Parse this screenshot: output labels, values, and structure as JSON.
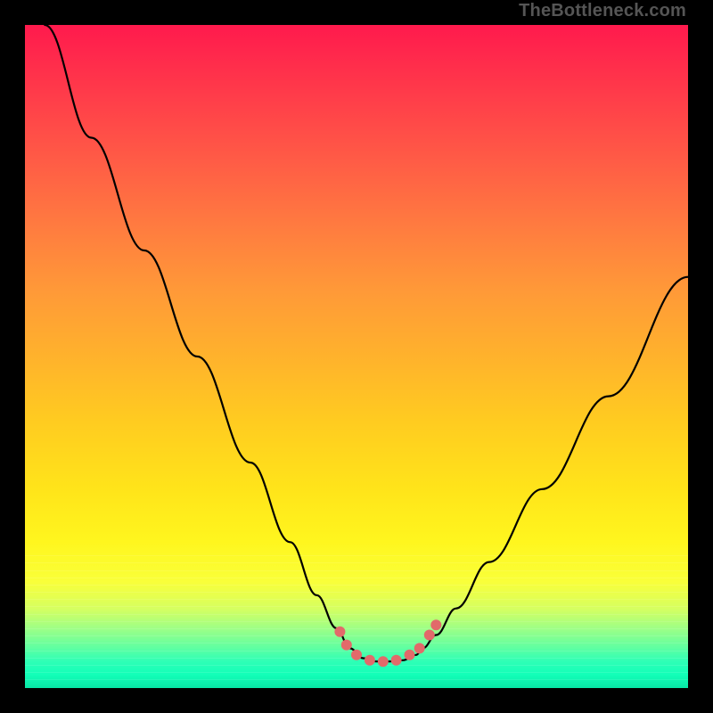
{
  "watermark": "TheBottleneck.com",
  "chart_data": {
    "type": "line",
    "title": "",
    "xlabel": "",
    "ylabel": "",
    "xlim": [
      0,
      100
    ],
    "ylim": [
      0,
      100
    ],
    "series": [
      {
        "name": "bottleneck-curve",
        "x": [
          3,
          10,
          18,
          26,
          34,
          40,
          44,
          47,
          49,
          51,
          53,
          55,
          57,
          59,
          60,
          62,
          65,
          70,
          78,
          88,
          100
        ],
        "y": [
          100,
          83,
          66,
          50,
          34,
          22,
          14,
          9,
          6,
          4.5,
          4,
          4,
          4.2,
          5,
          6,
          8,
          12,
          19,
          30,
          44,
          62
        ]
      }
    ],
    "markers": {
      "name": "highlight-dots",
      "color": "#e26a6a",
      "points": [
        {
          "x": 47.5,
          "y": 8.5
        },
        {
          "x": 48.5,
          "y": 6.5
        },
        {
          "x": 50,
          "y": 5
        },
        {
          "x": 52,
          "y": 4.2
        },
        {
          "x": 54,
          "y": 4
        },
        {
          "x": 56,
          "y": 4.2
        },
        {
          "x": 58,
          "y": 5
        },
        {
          "x": 59.5,
          "y": 6
        },
        {
          "x": 61,
          "y": 8
        },
        {
          "x": 62,
          "y": 9.5
        }
      ]
    },
    "gradient_stops": [
      {
        "pos": 0,
        "color": "#ff1a4d"
      },
      {
        "pos": 50,
        "color": "#ffb22c"
      },
      {
        "pos": 78,
        "color": "#fff61e"
      },
      {
        "pos": 100,
        "color": "#08e6a6"
      }
    ]
  }
}
